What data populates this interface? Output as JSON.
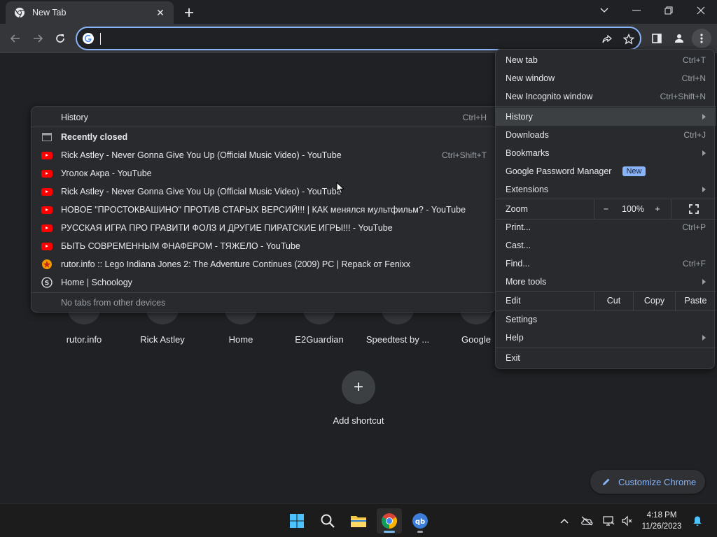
{
  "tab": {
    "title": "New Tab",
    "close": "✕"
  },
  "omnibox": {
    "value": "",
    "placeholder": ""
  },
  "shortcuts": [
    {
      "label": "rutor.info"
    },
    {
      "label": "Rick Astley"
    },
    {
      "label": "Home"
    },
    {
      "label": "E2Guardian"
    },
    {
      "label": "Speedtest by ..."
    },
    {
      "label": "Google"
    }
  ],
  "add_shortcut": {
    "icon": "+",
    "label": "Add shortcut"
  },
  "customize": {
    "label": "Customize Chrome"
  },
  "menu": {
    "new_tab": {
      "label": "New tab",
      "shortcut": "Ctrl+T"
    },
    "new_window": {
      "label": "New window",
      "shortcut": "Ctrl+N"
    },
    "new_incognito": {
      "label": "New Incognito window",
      "shortcut": "Ctrl+Shift+N"
    },
    "history": {
      "label": "History"
    },
    "downloads": {
      "label": "Downloads",
      "shortcut": "Ctrl+J"
    },
    "bookmarks": {
      "label": "Bookmarks"
    },
    "password_manager": {
      "label": "Google Password Manager",
      "badge": "New"
    },
    "extensions": {
      "label": "Extensions"
    },
    "zoom": {
      "label": "Zoom",
      "minus": "−",
      "value": "100%",
      "plus": "+"
    },
    "print": {
      "label": "Print...",
      "shortcut": "Ctrl+P"
    },
    "cast": {
      "label": "Cast..."
    },
    "find": {
      "label": "Find...",
      "shortcut": "Ctrl+F"
    },
    "more_tools": {
      "label": "More tools"
    },
    "edit": {
      "label": "Edit",
      "cut": "Cut",
      "copy": "Copy",
      "paste": "Paste"
    },
    "settings": {
      "label": "Settings"
    },
    "help": {
      "label": "Help"
    },
    "exit": {
      "label": "Exit"
    }
  },
  "history_menu": {
    "history": {
      "label": "History",
      "shortcut": "Ctrl+H"
    },
    "recently_closed": "Recently closed",
    "items": [
      {
        "label": "Rick Astley - Never Gonna Give You Up (Official Music Video) - YouTube",
        "shortcut": "Ctrl+Shift+T",
        "icon": "youtube-icon"
      },
      {
        "label": "Уголок Акра - YouTube",
        "shortcut": "",
        "icon": "youtube-icon"
      },
      {
        "label": "Rick Astley - Never Gonna Give You Up (Official Music Video) - YouTube",
        "shortcut": "",
        "icon": "youtube-icon"
      },
      {
        "label": "НОВОЕ \"ПРОСТОКВАШИНО\" ПРОТИВ СТАРЫХ ВЕРСИЙ!!! | КАК менялся мультфильм? - YouTube",
        "shortcut": "",
        "icon": "youtube-icon"
      },
      {
        "label": "РУССКАЯ ИГРА ПРО ГРАВИТИ ФОЛЗ И ДРУГИЕ ПИРАТСКИЕ ИГРЫ!!! - YouTube",
        "shortcut": "",
        "icon": "youtube-icon"
      },
      {
        "label": "БЫТЬ СОВРЕМЕННЫМ ФНАФЕРОМ - ТЯЖЕЛО - YouTube",
        "shortcut": "",
        "icon": "youtube-icon"
      },
      {
        "label": "rutor.info :: Lego Indiana Jones 2: The Adventure Continues (2009) PC | Repack от Fenixx",
        "shortcut": "",
        "icon": "rutor-icon"
      },
      {
        "label": "Home | Schoology",
        "shortcut": "",
        "icon": "schoology-icon"
      }
    ],
    "no_tabs": "No tabs from other devices"
  },
  "taskbar": {
    "clock_time": "4:18 PM",
    "clock_date": "11/26/2023"
  },
  "colors": {
    "background": "#202124",
    "toolbar": "#35363a",
    "menu": "#292a2d",
    "accent": "#8ab4f8"
  }
}
